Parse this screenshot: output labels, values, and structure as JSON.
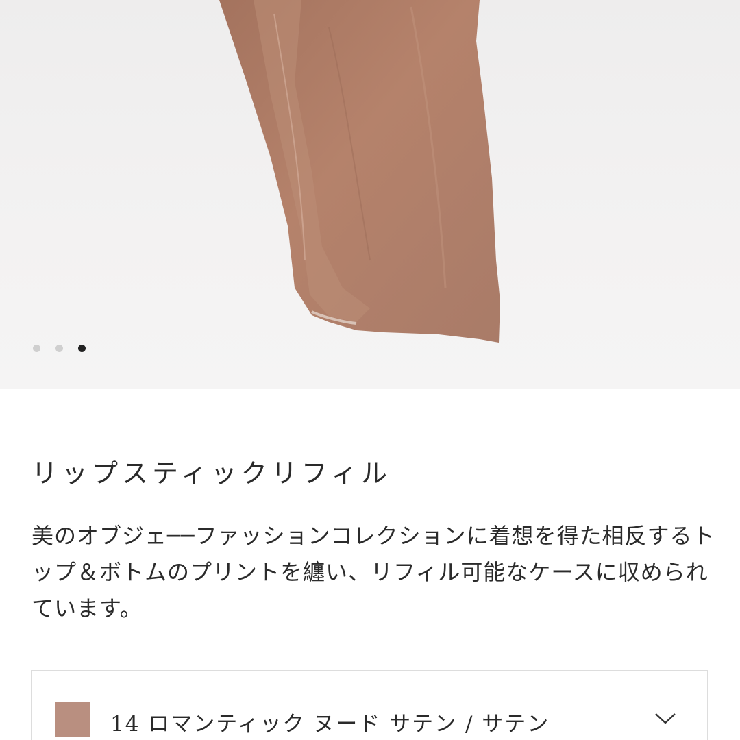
{
  "carousel": {
    "slide_count": 3,
    "active_slide": 3,
    "swatch_color": "#b0806a",
    "dot_color": "#cfcfcf",
    "active_dot_color": "#222222"
  },
  "product": {
    "title": "リップスティックリフィル",
    "description": "美のオブジェ──ファッションコレクションに着想を得た相反するトップ＆ボトムのプリントを纏い、リフィル可能なケースに収められています。"
  },
  "shade_selector": {
    "selected_label": "14 ロマンティック ヌード サテン / サテン",
    "chip_color": "#b98f80",
    "icon": "chevron-down-icon"
  }
}
